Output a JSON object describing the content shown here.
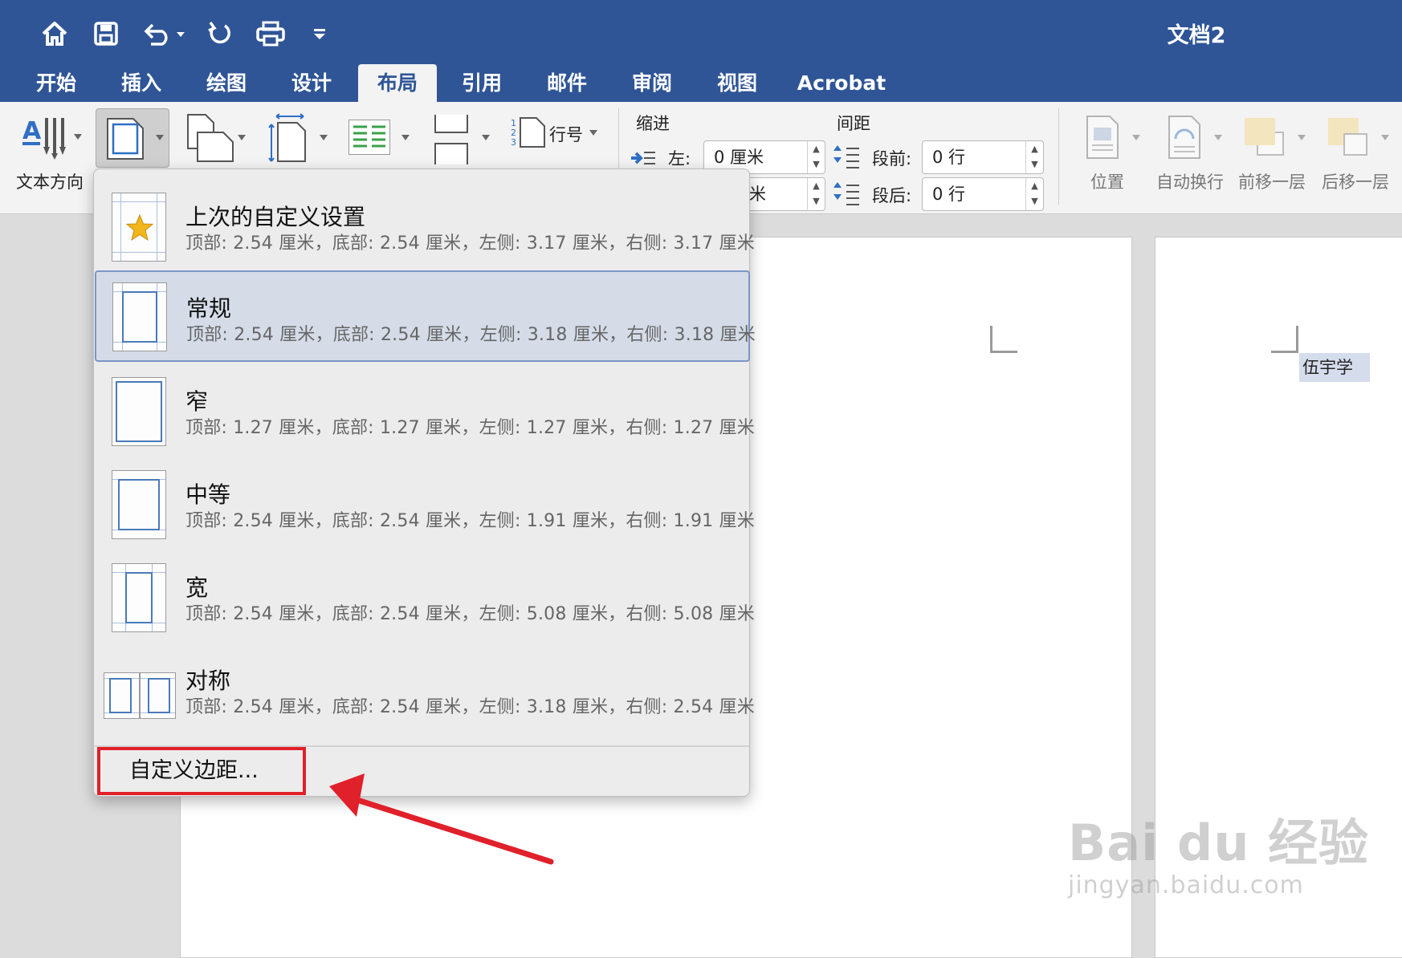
{
  "title_bar": {
    "document_title": "文档2",
    "quick_access_icons": [
      "home-icon",
      "save-icon",
      "undo-icon",
      "redo-icon",
      "print-icon",
      "customize-icon"
    ]
  },
  "tabs": [
    {
      "label": "开始"
    },
    {
      "label": "插入"
    },
    {
      "label": "绘图"
    },
    {
      "label": "设计"
    },
    {
      "label": "布局",
      "active": true
    },
    {
      "label": "引用"
    },
    {
      "label": "邮件"
    },
    {
      "label": "审阅"
    },
    {
      "label": "视图"
    },
    {
      "label": "Acrobat"
    }
  ],
  "ribbon": {
    "text_direction_label": "文本方向",
    "line_numbers_label": "行号",
    "indent": {
      "group_label": "缩进",
      "left_label": "左:",
      "left_value": "0 厘米",
      "right_value_partial": "米"
    },
    "spacing": {
      "group_label": "间距",
      "before_label": "段前:",
      "before_value": "0 行",
      "after_label": "段后:",
      "after_value": "0 行"
    },
    "arrange": {
      "position_label": "位置",
      "wrap_label": "自动换行",
      "bring_forward_label": "前移一层",
      "send_backward_label": "后移一层"
    }
  },
  "margins_menu": {
    "presets": [
      {
        "name": "上次的自定义设置",
        "desc": "顶部: 2.54 厘米，底部: 2.54 厘米，左侧: 3.17 厘米，右侧: 3.17 厘米",
        "icon": "star-icon"
      },
      {
        "name": "常规",
        "desc": "顶部: 2.54 厘米，底部: 2.54 厘米，左侧: 3.18 厘米，右侧: 3.18 厘米",
        "selected": true
      },
      {
        "name": "窄",
        "desc": "顶部: 1.27 厘米，底部: 1.27 厘米，左侧: 1.27 厘米，右侧: 1.27 厘米"
      },
      {
        "name": "中等",
        "desc": "顶部: 2.54 厘米，底部: 2.54 厘米，左侧: 1.91 厘米，右侧: 1.91 厘米"
      },
      {
        "name": "宽",
        "desc": "顶部: 2.54 厘米，底部: 2.54 厘米，左侧: 5.08 厘米，右侧: 5.08 厘米"
      },
      {
        "name": "对称",
        "desc": "顶部: 2.54 厘米，底部: 2.54 厘米，左侧: 3.18 厘米，右侧: 2.54 厘米"
      }
    ],
    "custom_margins_label": "自定义边距..."
  },
  "document": {
    "selected_text": "伍宇学"
  },
  "watermark": {
    "main": "Bai du 经验",
    "sub": "jingyan.baidu.com"
  },
  "colors": {
    "ribbon_blue": "#2f5597",
    "highlight_red": "#e0202a",
    "selection": "#d5dcec"
  }
}
